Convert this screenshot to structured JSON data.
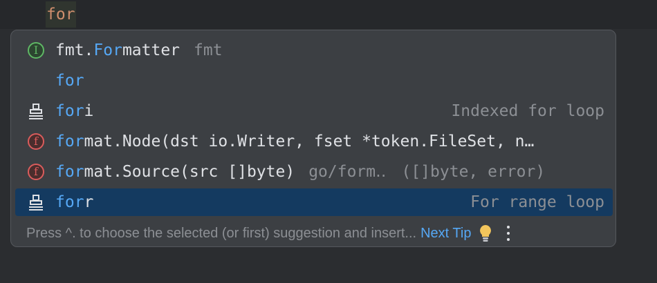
{
  "editor": {
    "typed_text": "for"
  },
  "popup": {
    "items": [
      {
        "icon": "interface-icon",
        "icon_letter": "I",
        "match": "fmt.",
        "highlight": "For",
        "rest": "matter",
        "pkg": "fmt",
        "type": ""
      },
      {
        "icon": "none",
        "icon_letter": "",
        "match": "",
        "highlight": "for",
        "rest": "",
        "pkg": "",
        "type": ""
      },
      {
        "icon": "live-template-icon",
        "icon_letter": "",
        "match": "",
        "highlight": "for",
        "rest": "i",
        "pkg": "",
        "type": "Indexed for loop"
      },
      {
        "icon": "function-icon",
        "icon_letter": "f",
        "match": "",
        "highlight": "for",
        "rest": "mat.Node(dst io.Writer, fset *token.FileSet, n…",
        "pkg": "",
        "type": ""
      },
      {
        "icon": "function-icon",
        "icon_letter": "f",
        "match": "",
        "highlight": "for",
        "rest": "mat.Source(src []byte)",
        "pkg": "go/form‥",
        "type": "([]byte, error)"
      },
      {
        "icon": "live-template-icon",
        "icon_letter": "",
        "match": "",
        "highlight": "for",
        "rest": "r",
        "pkg": "",
        "type": "For range loop",
        "selected": true
      }
    ],
    "footer": {
      "hint": "Press ^. to choose the selected (or first) suggestion and insert...",
      "next_tip": "Next Tip"
    },
    "colors": {
      "selected_bg": "#143a60",
      "accent": "#56a8f5",
      "keyword": "#cf8e6d"
    }
  }
}
